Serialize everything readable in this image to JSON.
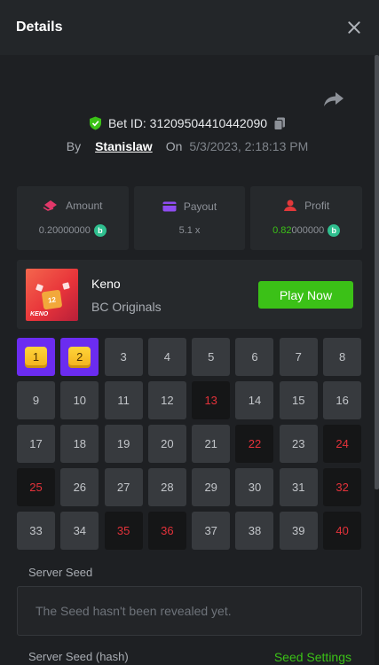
{
  "header": {
    "title": "Details"
  },
  "bet": {
    "id_label": "Bet ID: 31209504410442090",
    "by_label": "By",
    "username": "Stanislaw",
    "on_label": "On",
    "date": "5/3/2023, 2:18:13 PM"
  },
  "stats": {
    "amount": {
      "label": "Amount",
      "value_dim": "0.2",
      "value_rest": "0000000"
    },
    "payout": {
      "label": "Payout",
      "value": "5.1 x"
    },
    "profit": {
      "label": "Profit",
      "value_hi": "0.82",
      "value_rest": "000000"
    },
    "coin_glyph": "b"
  },
  "game": {
    "thumb_tile": "12",
    "thumb_name": "KENO",
    "name": "Keno",
    "provider": "BC Originals",
    "play_label": "Play Now"
  },
  "grid": [
    {
      "n": "1",
      "s": "hit"
    },
    {
      "n": "2",
      "s": "hit"
    },
    {
      "n": "3",
      "s": "n"
    },
    {
      "n": "4",
      "s": "n"
    },
    {
      "n": "5",
      "s": "n"
    },
    {
      "n": "6",
      "s": "n"
    },
    {
      "n": "7",
      "s": "n"
    },
    {
      "n": "8",
      "s": "n"
    },
    {
      "n": "9",
      "s": "n"
    },
    {
      "n": "10",
      "s": "n"
    },
    {
      "n": "11",
      "s": "n"
    },
    {
      "n": "12",
      "s": "n"
    },
    {
      "n": "13",
      "s": "miss"
    },
    {
      "n": "14",
      "s": "n"
    },
    {
      "n": "15",
      "s": "n"
    },
    {
      "n": "16",
      "s": "n"
    },
    {
      "n": "17",
      "s": "n"
    },
    {
      "n": "18",
      "s": "n"
    },
    {
      "n": "19",
      "s": "n"
    },
    {
      "n": "20",
      "s": "n"
    },
    {
      "n": "21",
      "s": "n"
    },
    {
      "n": "22",
      "s": "miss"
    },
    {
      "n": "23",
      "s": "n"
    },
    {
      "n": "24",
      "s": "miss"
    },
    {
      "n": "25",
      "s": "miss"
    },
    {
      "n": "26",
      "s": "n"
    },
    {
      "n": "27",
      "s": "n"
    },
    {
      "n": "28",
      "s": "n"
    },
    {
      "n": "29",
      "s": "n"
    },
    {
      "n": "30",
      "s": "n"
    },
    {
      "n": "31",
      "s": "n"
    },
    {
      "n": "32",
      "s": "miss"
    },
    {
      "n": "33",
      "s": "n"
    },
    {
      "n": "34",
      "s": "n"
    },
    {
      "n": "35",
      "s": "miss"
    },
    {
      "n": "36",
      "s": "miss"
    },
    {
      "n": "37",
      "s": "n"
    },
    {
      "n": "38",
      "s": "n"
    },
    {
      "n": "39",
      "s": "n"
    },
    {
      "n": "40",
      "s": "miss"
    }
  ],
  "seed": {
    "server_label": "Server Seed",
    "server_placeholder": "The Seed hasn't been revealed yet.",
    "hash_label": "Server Seed (hash)",
    "settings_link": "Seed Settings"
  },
  "colors": {
    "accent_green": "#3bc117",
    "hit_purple": "#6b2cf0",
    "miss_red": "#e4323a"
  }
}
